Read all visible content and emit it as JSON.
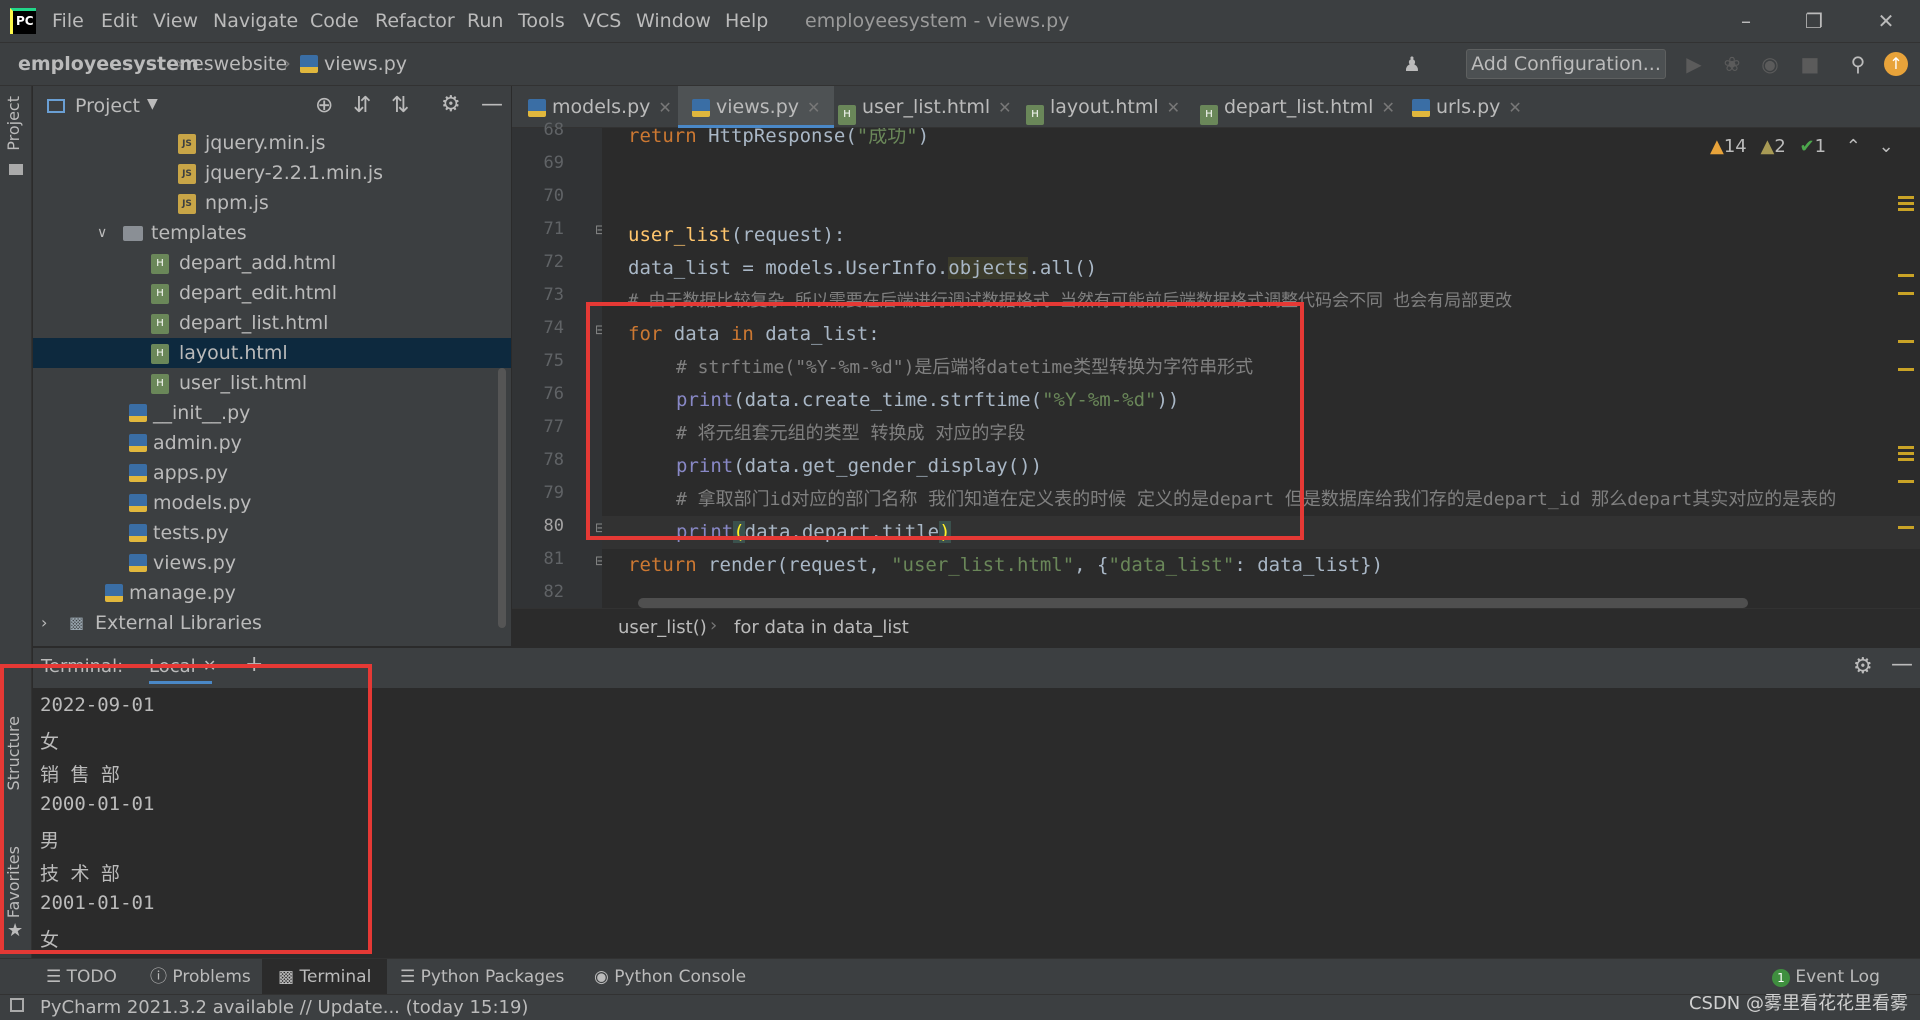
{
  "menubar": {
    "items": [
      "File",
      "Edit",
      "View",
      "Navigate",
      "Code",
      "Refactor",
      "Run",
      "Tools",
      "VCS",
      "Window",
      "Help"
    ],
    "window_title": "employeesystem - views.py"
  },
  "navbar": {
    "breadcrumbs": [
      "employeesystem",
      "eswebsite",
      "views.py"
    ],
    "add_configuration": "Add Configuration..."
  },
  "project_panel": {
    "title": "Project",
    "items": [
      {
        "label": "jquery.min.js",
        "type": "js"
      },
      {
        "label": "jquery-2.2.1.min.js",
        "type": "js"
      },
      {
        "label": "npm.js",
        "type": "js"
      },
      {
        "label": "templates",
        "type": "folder"
      },
      {
        "label": "depart_add.html",
        "type": "html"
      },
      {
        "label": "depart_edit.html",
        "type": "html"
      },
      {
        "label": "depart_list.html",
        "type": "html"
      },
      {
        "label": "layout.html",
        "type": "html"
      },
      {
        "label": "user_list.html",
        "type": "html"
      },
      {
        "label": "__init__.py",
        "type": "py"
      },
      {
        "label": "admin.py",
        "type": "py"
      },
      {
        "label": "apps.py",
        "type": "py"
      },
      {
        "label": "models.py",
        "type": "py"
      },
      {
        "label": "tests.py",
        "type": "py"
      },
      {
        "label": "views.py",
        "type": "py"
      },
      {
        "label": "manage.py",
        "type": "py"
      },
      {
        "label": "External Libraries",
        "type": "lib"
      }
    ]
  },
  "side_tabs": {
    "project": "Project",
    "structure": "Structure",
    "favorites": "Favorites"
  },
  "editor_tabs": [
    "models.py",
    "views.py",
    "user_list.html",
    "layout.html",
    "depart_list.html",
    "urls.py"
  ],
  "inspections": {
    "warnings": "14",
    "weak_warnings": "2",
    "ok": "1"
  },
  "code_lines": {
    "n68": "68",
    "n69": "69",
    "n70": "70",
    "n71": "71",
    "n72": "72",
    "n73": "73",
    "n74": "74",
    "n75": "75",
    "n76": "76",
    "n77": "77",
    "n78": "78",
    "n79": "79",
    "n80": "80",
    "n81": "81",
    "n82": "82",
    "l68_kw": "return",
    "l68_rest": " HttpResponse(",
    "l68_str": "\"成功\"",
    "l68_end": ")",
    "l71_fn": "user_list",
    "l71_rest": "(request):",
    "l72_a": "data_list = models.UserInfo.",
    "l72_hl": "objects",
    "l72_b": ".all()",
    "l73": "# 由于数据比较复杂 所以需要在后端进行调试数据格式 当然有可能前后端数据格式调整代码会不同 也会有局部更改",
    "l74_kw1": "for",
    "l74_a": " data ",
    "l74_kw2": "in",
    "l74_b": " data_list:",
    "l75": "# strftime(\"%Y-%m-%d\")是后端将datetime类型转换为字符串形式",
    "l76_bi": "print",
    "l76_a": "(data.create_time.strftime(",
    "l76_str": "\"%Y-%m-%d\"",
    "l76_b": "))",
    "l77": "# 将元组套元组的类型 转换成 对应的字段",
    "l78_bi": "print",
    "l78_a": "(data.get_gender_display())",
    "l79": "# 拿取部门id对应的部门名称 我们知道在定义表的时候 定义的是depart 但是数据库给我们存的是depart_id 那么depart其实对应的是表的",
    "l80_bi": "print",
    "l80_b1": "(",
    "l80_a": "data.depart.title",
    "l80_b2": ")",
    "l81_kw": "return",
    "l81_a": " render(request, ",
    "l81_s1": "\"user_list.html\"",
    "l81_b": ", {",
    "l81_s2": "\"data_list\"",
    "l81_c": ": data_list})"
  },
  "editor_breadcrumb": [
    "user_list()",
    "for data in data_list"
  ],
  "terminal": {
    "tab_label": "Terminal:",
    "session": "Local",
    "lines": [
      "2022-09-01",
      "女",
      "销 售 部",
      "2000-01-01",
      "男",
      "技 术 部",
      "2001-01-01",
      "女"
    ]
  },
  "bottom_tabs": [
    "TODO",
    "Problems",
    "Terminal",
    "Python Packages",
    "Python Console"
  ],
  "event_log": {
    "label": "Event Log",
    "count": "1"
  },
  "status": {
    "message": "PyCharm 2021.3.2 available // Update... (today 15:19)",
    "watermark": "CSDN @雾里看花花里看雾"
  },
  "colors": {
    "keyword": "#cc7832",
    "function": "#ffc66d",
    "string": "#6a8759",
    "comment": "#808080",
    "builtin": "#8888c6",
    "annotation_red": "#e53935"
  }
}
